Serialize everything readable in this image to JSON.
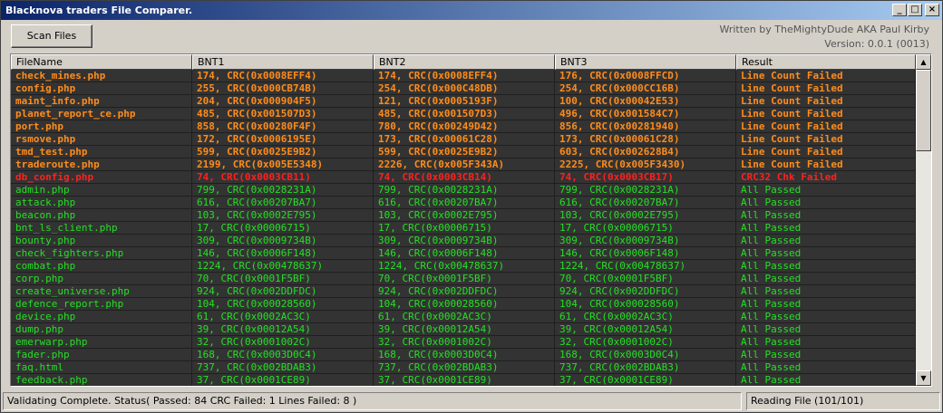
{
  "window": {
    "title": "Blacknova traders File Comparer.",
    "controls": {
      "minimize": "_",
      "maximize": "□",
      "close": "×"
    }
  },
  "toolbar": {
    "scan_label": "Scan Files"
  },
  "credits": {
    "author": "Written by TheMightyDude AKA Paul Kirby",
    "version": "Version: 0.0.1 (0013)"
  },
  "table": {
    "columns": [
      "FileName",
      "BNT1",
      "BNT2",
      "BNT3",
      "Result"
    ],
    "rows": [
      {
        "status": "fail",
        "cells": [
          "check_mines.php",
          "174, CRC(0x0008EFF4)",
          "174, CRC(0x0008EFF4)",
          "176, CRC(0x0008FFCD)",
          "Line Count Failed"
        ]
      },
      {
        "status": "fail",
        "cells": [
          "config.php",
          "255, CRC(0x000CB74B)",
          "254, CRC(0x000C48DB)",
          "254, CRC(0x000CC16B)",
          "Line Count Failed"
        ]
      },
      {
        "status": "fail",
        "cells": [
          "maint_info.php",
          "204, CRC(0x000904F5)",
          "121, CRC(0x0005193F)",
          "100, CRC(0x00042E53)",
          "Line Count Failed"
        ]
      },
      {
        "status": "fail",
        "cells": [
          "planet_report_ce.php",
          "485, CRC(0x001507D3)",
          "485, CRC(0x001507D3)",
          "496, CRC(0x001584C7)",
          "Line Count Failed"
        ]
      },
      {
        "status": "fail",
        "cells": [
          "port.php",
          "858, CRC(0x00280F4F)",
          "780, CRC(0x00249D42)",
          "856, CRC(0x00281940)",
          "Line Count Failed"
        ]
      },
      {
        "status": "fail",
        "cells": [
          "rsmove.php",
          "172, CRC(0x0006195E)",
          "173, CRC(0x00061C28)",
          "173, CRC(0x00061C28)",
          "Line Count Failed"
        ]
      },
      {
        "status": "fail",
        "cells": [
          "tmd_test.php",
          "599, CRC(0x0025E9B2)",
          "599, CRC(0x0025E9B2)",
          "603, CRC(0x002628B4)",
          "Line Count Failed"
        ]
      },
      {
        "status": "fail",
        "cells": [
          "traderoute.php",
          "2199, CRC(0x005E5348)",
          "2226, CRC(0x005F343A)",
          "2225, CRC(0x005F3430)",
          "Line Count Failed"
        ]
      },
      {
        "status": "crcfail",
        "cells": [
          "db_config.php",
          "74, CRC(0x0003CB11)",
          "74, CRC(0x0003CB14)",
          "74, CRC(0x0003CB17)",
          "CRC32 Chk Failed"
        ]
      },
      {
        "status": "pass",
        "cells": [
          "admin.php",
          "799, CRC(0x0028231A)",
          "799, CRC(0x0028231A)",
          "799, CRC(0x0028231A)",
          "All Passed"
        ]
      },
      {
        "status": "pass",
        "cells": [
          "attack.php",
          "616, CRC(0x00207BA7)",
          "616, CRC(0x00207BA7)",
          "616, CRC(0x00207BA7)",
          "All Passed"
        ]
      },
      {
        "status": "pass",
        "cells": [
          "beacon.php",
          "103, CRC(0x0002E795)",
          "103, CRC(0x0002E795)",
          "103, CRC(0x0002E795)",
          "All Passed"
        ]
      },
      {
        "status": "pass",
        "cells": [
          "bnt_ls_client.php",
          "17, CRC(0x00006715)",
          "17, CRC(0x00006715)",
          "17, CRC(0x00006715)",
          "All Passed"
        ]
      },
      {
        "status": "pass",
        "cells": [
          "bounty.php",
          "309, CRC(0x0009734B)",
          "309, CRC(0x0009734B)",
          "309, CRC(0x0009734B)",
          "All Passed"
        ]
      },
      {
        "status": "pass",
        "cells": [
          "check_fighters.php",
          "146, CRC(0x0006F148)",
          "146, CRC(0x0006F148)",
          "146, CRC(0x0006F148)",
          "All Passed"
        ]
      },
      {
        "status": "pass",
        "cells": [
          "combat.php",
          "1224, CRC(0x00478637)",
          "1224, CRC(0x00478637)",
          "1224, CRC(0x00478637)",
          "All Passed"
        ]
      },
      {
        "status": "pass",
        "cells": [
          "corp.php",
          "70, CRC(0x0001F5BF)",
          "70, CRC(0x0001F5BF)",
          "70, CRC(0x0001F5BF)",
          "All Passed"
        ]
      },
      {
        "status": "pass",
        "cells": [
          "create_universe.php",
          "924, CRC(0x002DDFDC)",
          "924, CRC(0x002DDFDC)",
          "924, CRC(0x002DDFDC)",
          "All Passed"
        ]
      },
      {
        "status": "pass",
        "cells": [
          "defence_report.php",
          "104, CRC(0x00028560)",
          "104, CRC(0x00028560)",
          "104, CRC(0x00028560)",
          "All Passed"
        ]
      },
      {
        "status": "pass",
        "cells": [
          "device.php",
          "61, CRC(0x0002AC3C)",
          "61, CRC(0x0002AC3C)",
          "61, CRC(0x0002AC3C)",
          "All Passed"
        ]
      },
      {
        "status": "pass",
        "cells": [
          "dump.php",
          "39, CRC(0x00012A54)",
          "39, CRC(0x00012A54)",
          "39, CRC(0x00012A54)",
          "All Passed"
        ]
      },
      {
        "status": "pass",
        "cells": [
          "emerwarp.php",
          "32, CRC(0x0001002C)",
          "32, CRC(0x0001002C)",
          "32, CRC(0x0001002C)",
          "All Passed"
        ]
      },
      {
        "status": "pass",
        "cells": [
          "fader.php",
          "168, CRC(0x0003D0C4)",
          "168, CRC(0x0003D0C4)",
          "168, CRC(0x0003D0C4)",
          "All Passed"
        ]
      },
      {
        "status": "pass",
        "cells": [
          "faq.html",
          "737, CRC(0x002BDAB3)",
          "737, CRC(0x002BDAB3)",
          "737, CRC(0x002BDAB3)",
          "All Passed"
        ]
      },
      {
        "status": "pass",
        "cells": [
          "feedback.php",
          "37, CRC(0x0001CE89)",
          "37, CRC(0x0001CE89)",
          "37, CRC(0x0001CE89)",
          "All Passed"
        ]
      }
    ]
  },
  "scrollbar": {
    "up_icon": "▲",
    "down_icon": "▼"
  },
  "statusbar": {
    "left": "Validating Complete. Status( Passed: 84 CRC Failed: 1 Lines Failed: 8 )",
    "right": "Reading File (101/101)"
  }
}
